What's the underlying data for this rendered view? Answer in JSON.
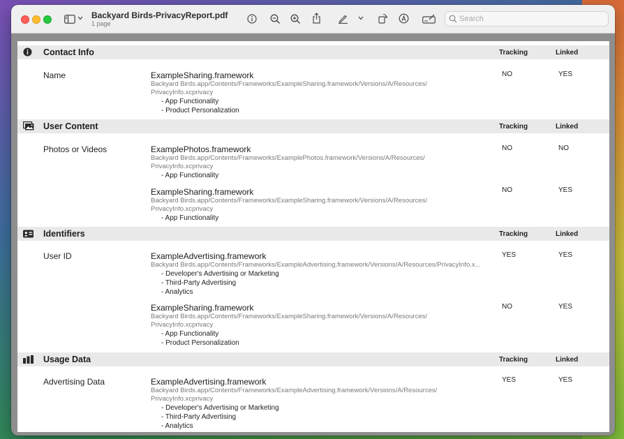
{
  "window": {
    "title": "Backyard Birds-PrivacyReport.pdf",
    "subtitle": "1 page",
    "search_placeholder": "Search"
  },
  "toolbar": {
    "icons": [
      "sidebar-icon",
      "chevron-down-icon",
      "info-icon",
      "zoom-out-icon",
      "zoom-in-icon",
      "share-icon",
      "highlight-pen-icon",
      "chevron-down-icon",
      "rotate-icon",
      "markup-icon",
      "form-fill-icon",
      "search-icon"
    ]
  },
  "columns": {
    "tracking": "Tracking",
    "linked": "Linked"
  },
  "sections": [
    {
      "title": "Contact Info",
      "icon": "info-circle-icon",
      "rows": [
        {
          "data_type": "Name",
          "entries": [
            {
              "framework": "ExampleSharing.framework",
              "path1": "Backyard Birds.app/Contents/Frameworks/ExampleSharing.framework/Versions/A/Resources/",
              "path2": "PrivacyInfo.xcprivacy",
              "purposes": [
                "- App Functionality",
                "- Product Personalization"
              ],
              "tracking": "NO",
              "linked": "YES"
            }
          ]
        }
      ]
    },
    {
      "title": "User Content",
      "icon": "photos-icon",
      "rows": [
        {
          "data_type": "Photos or Videos",
          "entries": [
            {
              "framework": "ExamplePhotos.framework",
              "path1": "Backyard Birds.app/Contents/Frameworks/ExamplePhotos.framework/Versions/A/Resources/",
              "path2": "PrivacyInfo.xcprivacy",
              "purposes": [
                "- App Functionality"
              ],
              "tracking": "NO",
              "linked": "NO"
            },
            {
              "framework": "ExampleSharing.framework",
              "path1": "Backyard Birds.app/Contents/Frameworks/ExampleSharing.framework/Versions/A/Resources/",
              "path2": "PrivacyInfo.xcprivacy",
              "purposes": [
                "- App Functionality"
              ],
              "tracking": "NO",
              "linked": "YES"
            }
          ]
        }
      ]
    },
    {
      "title": "Identifiers",
      "icon": "id-card-icon",
      "rows": [
        {
          "data_type": "User ID",
          "entries": [
            {
              "framework": "ExampleAdvertising.framework",
              "path1": "Backyard Birds.app/Contents/Frameworks/ExampleAdvertising.framework/Versions/A/Resources/PrivacyInfo.x...",
              "path2": "",
              "purposes": [
                "- Developer's Advertising or Marketing",
                "- Third-Party Advertising",
                "- Analytics"
              ],
              "tracking": "YES",
              "linked": "YES"
            },
            {
              "framework": "ExampleSharing.framework",
              "path1": "Backyard Birds.app/Contents/Frameworks/ExampleSharing.framework/Versions/A/Resources/",
              "path2": "PrivacyInfo.xcprivacy",
              "purposes": [
                "- App Functionality",
                "- Product Personalization"
              ],
              "tracking": "NO",
              "linked": "YES"
            }
          ]
        }
      ]
    },
    {
      "title": "Usage Data",
      "icon": "bar-chart-icon",
      "rows": [
        {
          "data_type": "Advertising Data",
          "entries": [
            {
              "framework": "ExampleAdvertising.framework",
              "path1": "Backyard Birds.app/Contents/Frameworks/ExampleAdvertising.framework/Versions/A/Resources/",
              "path2": "PrivacyInfo.xcprivacy",
              "purposes": [
                "- Developer's Advertising or Marketing",
                "- Third-Party Advertising",
                "- Analytics"
              ],
              "tracking": "YES",
              "linked": "YES"
            }
          ]
        }
      ]
    }
  ]
}
